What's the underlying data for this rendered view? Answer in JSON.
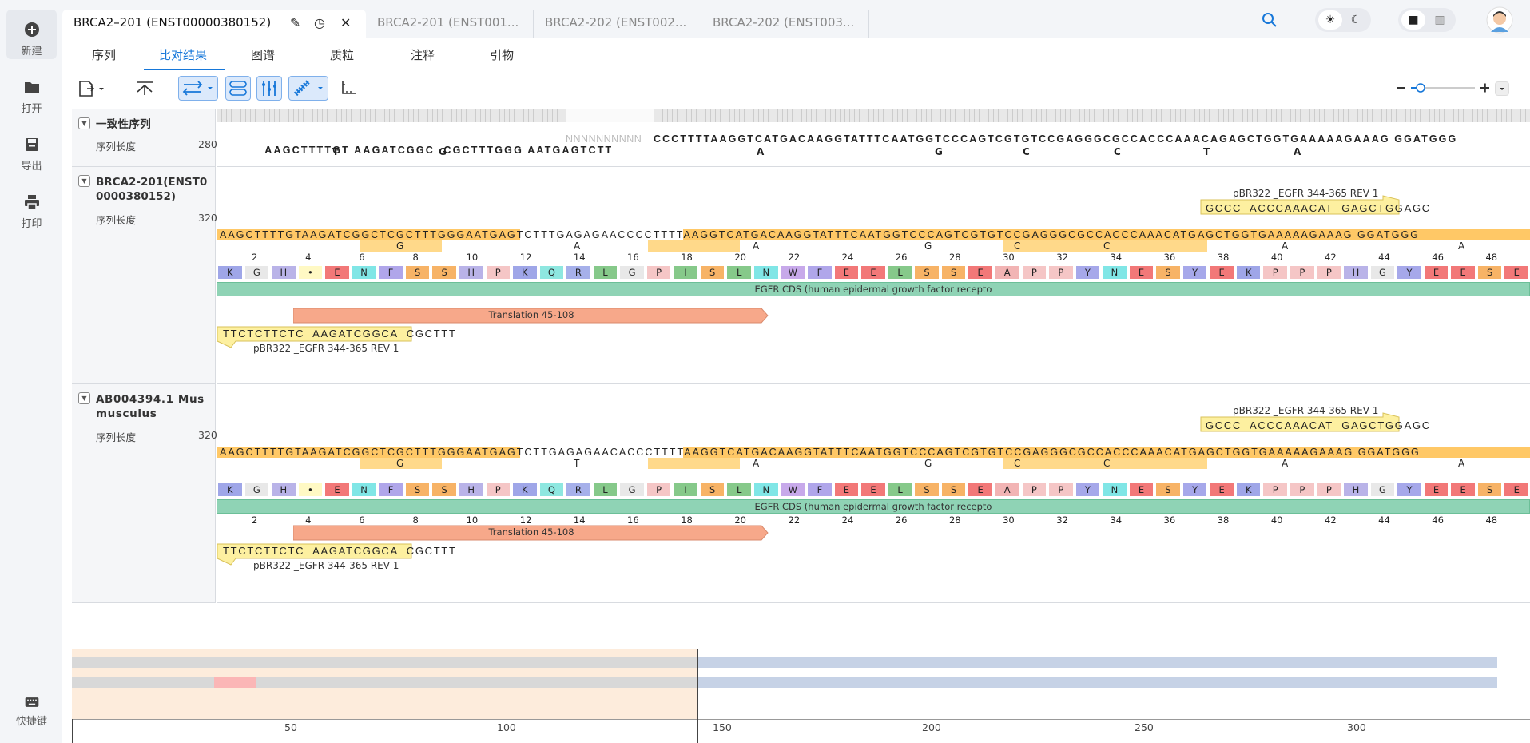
{
  "sidebar": {
    "items": [
      {
        "label": "新建",
        "icon": "plus-circle-icon"
      },
      {
        "label": "打开",
        "icon": "folder-icon"
      },
      {
        "label": "导出",
        "icon": "save-icon"
      },
      {
        "label": "打印",
        "icon": "printer-icon"
      }
    ],
    "shortcut_label": "快捷键"
  },
  "doc_tabs": [
    {
      "label": "BRCA2–201 (ENST00000380152)",
      "active": true
    },
    {
      "label": "BRCA2-201 (ENST001..."
    },
    {
      "label": "BRCA2-202 (ENST002..."
    },
    {
      "label": "BRCA2-202 (ENST003..."
    }
  ],
  "subtabs": [
    "序列",
    "比对结果",
    "图谱",
    "质粒",
    "注释",
    "引物"
  ],
  "active_subtab": "比对结果",
  "accent_color": "#1677d9",
  "consensus": {
    "title": "一致性序列",
    "length_label": "序列长度",
    "length": "280",
    "seq": "AAGCTTTTGT AAGATCGGC  CGCTTTGGG AATGAGTCTT",
    "gap": "NNNNNNNNNN",
    "seq2": "CCCTTTTAAGGTCATGACAAGGTATTTCAATGGTCCCAGTCGTGTCCGAGGGCGCCACCCAAACAGAGCTGGTGAAAAAGAAAG GGATGGG",
    "ambig": [
      {
        "char": "T",
        "pos": 0.088
      },
      {
        "char": "G",
        "pos": 0.169
      },
      {
        "char": "A",
        "pos": 0.411
      },
      {
        "char": "G",
        "pos": 0.547
      },
      {
        "char": "C",
        "pos": 0.614
      },
      {
        "char": "C",
        "pos": 0.683
      },
      {
        "char": "T",
        "pos": 0.751
      },
      {
        "char": "A",
        "pos": 0.82
      }
    ]
  },
  "sequences": [
    {
      "title": "BRCA2-201(ENST00000380152)",
      "length_label": "序列长度",
      "length": "320",
      "seq": "AAGCTTTTGTAAGATCGGCTCGCTTTGGGAATGAGTCTTTGAGAGAACCCCTTTTAAGGTCATGACAAGGTATTTCAATGGTCCCAGTCGTGTCCGAGGGCGCCACCCAAACATGAGCTGGTGAAAAAGAAAG GGATGGG",
      "below": [
        {
          "char": "G",
          "pos": 0.137
        },
        {
          "char": "A",
          "pos": 0.272
        },
        {
          "char": "A",
          "pos": 0.408
        },
        {
          "char": "G",
          "pos": 0.539
        },
        {
          "char": "C",
          "pos": 0.607
        },
        {
          "char": "C",
          "pos": 0.675
        },
        {
          "char": "A",
          "pos": 0.811
        },
        {
          "char": "A",
          "pos": 0.945
        }
      ]
    },
    {
      "title": "AB004394.1 Mus musculus",
      "length_label": "序列长度",
      "length": "320",
      "seq": "AAGCTTTTGTAAGATCGGCTCGCTTTGGGAATGAGTCTTGAGAGAACACCCTTTTAAGGTCATGACAAGGTATTTCAATGGTCCCAGTCGTGTCCGAGGGCGCCACCCAAACATGAGCTGGTGAAAAAGAAAG GGATGGG",
      "below": [
        {
          "char": "G",
          "pos": 0.137
        },
        {
          "char": "T",
          "pos": 0.272
        },
        {
          "char": "A",
          "pos": 0.408
        },
        {
          "char": "G",
          "pos": 0.539
        },
        {
          "char": "C",
          "pos": 0.607
        },
        {
          "char": "C",
          "pos": 0.675
        },
        {
          "char": "A",
          "pos": 0.811
        },
        {
          "char": "A",
          "pos": 0.945
        }
      ]
    }
  ],
  "ruler_numbers": [
    "2",
    "4",
    "6",
    "8",
    "10",
    "12",
    "14",
    "16",
    "18",
    "20",
    "22",
    "24",
    "26",
    "28",
    "30",
    "32",
    "34",
    "36",
    "38",
    "40",
    "42",
    "44",
    "46",
    "48"
  ],
  "amino_acids": [
    "K",
    "G",
    "H",
    "•",
    "E",
    "N",
    "F",
    "S",
    "S",
    "H",
    "P",
    "K",
    "Q",
    "R",
    "L",
    "G",
    "P",
    "I",
    "S",
    "L",
    "N",
    "W",
    "F",
    "E",
    "E",
    "L",
    "S",
    "S",
    "E",
    "A",
    "P",
    "P",
    "Y",
    "N",
    "E",
    "S",
    "Y",
    "E",
    "K",
    "P",
    "P",
    "P",
    "H",
    "G",
    "Y",
    "E",
    "E",
    "S",
    "E"
  ],
  "aa_colors": {
    "K": "#9fa6e8",
    "G": "#e8e8e8",
    "H": "#b9b3e8",
    "•": "#fff9c4",
    "E": "#f27878",
    "N": "#80e6e6",
    "F": "#b0a6ea",
    "S": "#f7b366",
    "P": "#f5c6c6",
    "Q": "#8ee7e0",
    "R": "#a6b0ea",
    "L": "#86c98a",
    "I": "#86c98a",
    "W": "#c7a9ea",
    "A": "#f2b4b4",
    "Y": "#a6a8ea"
  },
  "features": {
    "cds": "EGFR CDS (human epidermal growth factor recepto",
    "translation": "Translation 45-108",
    "primer_fwd_seq": "GCCC  ACCCAAACAT  GAGCTGGAGC",
    "primer_fwd_label": "pBR322 _EGFR 344-365 REV 1",
    "primer_rev_seq": "TTCTCTTCTC  AAGATCGGCA  CGCTTT",
    "primer_rev_label": "pBR322 _EGFR 344-365 REV 1"
  },
  "overview": {
    "ticks": [
      "50",
      "100",
      "150",
      "200",
      "250",
      "300"
    ]
  }
}
